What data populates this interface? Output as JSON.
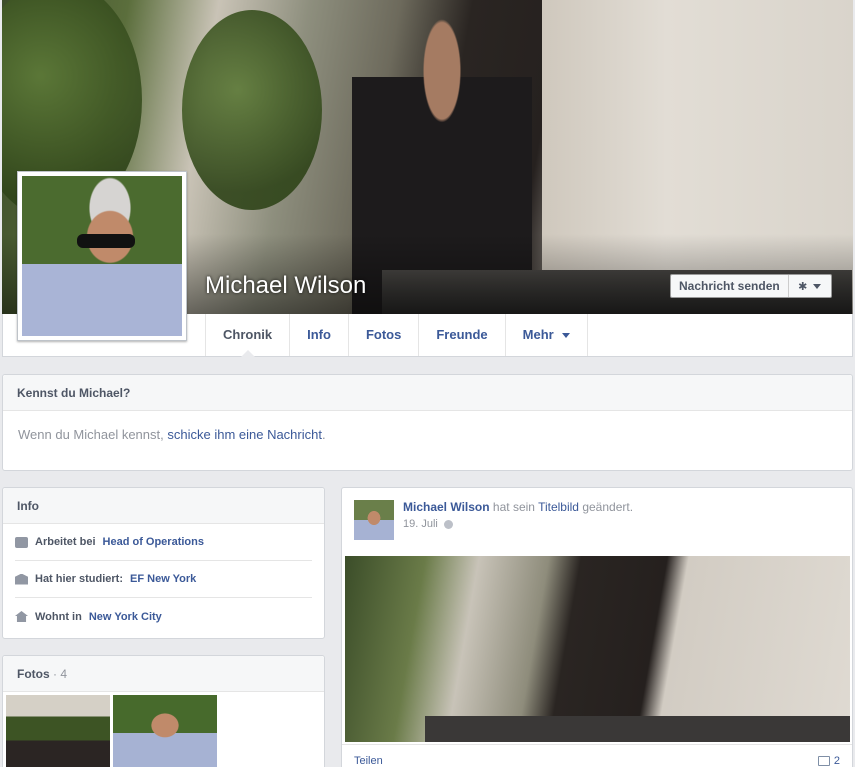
{
  "profile": {
    "name": "Michael Wilson"
  },
  "cover_actions": {
    "message_label": "Nachricht senden",
    "gear_symbol": "✱"
  },
  "tabs": [
    {
      "label": "Chronik",
      "active": true
    },
    {
      "label": "Info"
    },
    {
      "label": "Fotos"
    },
    {
      "label": "Freunde"
    },
    {
      "label": "Mehr"
    }
  ],
  "know_card": {
    "title": "Kennst du Michael?",
    "text": "Wenn du Michael kennst,",
    "link": "schicke ihm eine Nachricht",
    "end": "."
  },
  "info_card": {
    "title": "Info",
    "rows": [
      {
        "prefix": "Arbeitet bei",
        "link": "Head of Operations",
        "icon": "work-icon"
      },
      {
        "prefix": "Hat hier studiert:",
        "link": "EF New York",
        "icon": "school-icon"
      },
      {
        "prefix": "Wohnt in",
        "link": "New York City",
        "icon": "home-icon"
      }
    ]
  },
  "fotos_card": {
    "title": "Fotos",
    "count": "· 4"
  },
  "post": {
    "author": "Michael Wilson",
    "text_middle": "hat sein",
    "link": "Titelbild",
    "text_end": "geändert.",
    "date": "19. Juli",
    "share_label": "Teilen",
    "comment_count": "2"
  },
  "colors": {
    "link": "#3b5998",
    "muted": "#90949c",
    "background": "#e9eaed"
  }
}
